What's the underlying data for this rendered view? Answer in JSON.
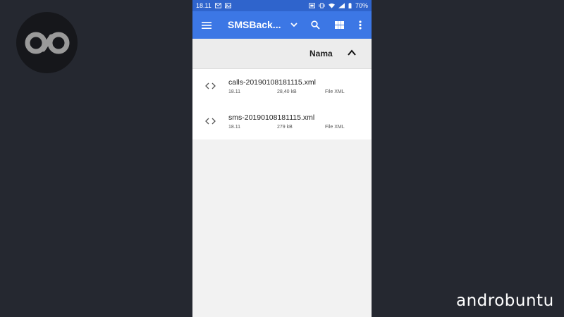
{
  "status_bar": {
    "time": "18.11",
    "battery": "70%"
  },
  "toolbar": {
    "title": "SMSBack...",
    "icons": [
      "menu-icon",
      "chevron-down-icon",
      "search-icon",
      "grid-view-icon",
      "more-vert-icon"
    ]
  },
  "sort": {
    "label": "Nama",
    "direction_icon": "chevron-up-icon"
  },
  "files": [
    {
      "name": "calls-20190108181115.xml",
      "time": "18.11",
      "size": "28,40 kB",
      "type": "File XML"
    },
    {
      "name": "sms-20190108181115.xml",
      "time": "18.11",
      "size": "279 kB",
      "type": "File XML"
    }
  ],
  "watermark": {
    "brand": "androbuntu"
  },
  "colors": {
    "background": "#252830",
    "status_bar": "#2f64cc",
    "toolbar": "#3c77e5",
    "list_bg": "#ffffff",
    "empty_bg": "#f2f2f2"
  }
}
